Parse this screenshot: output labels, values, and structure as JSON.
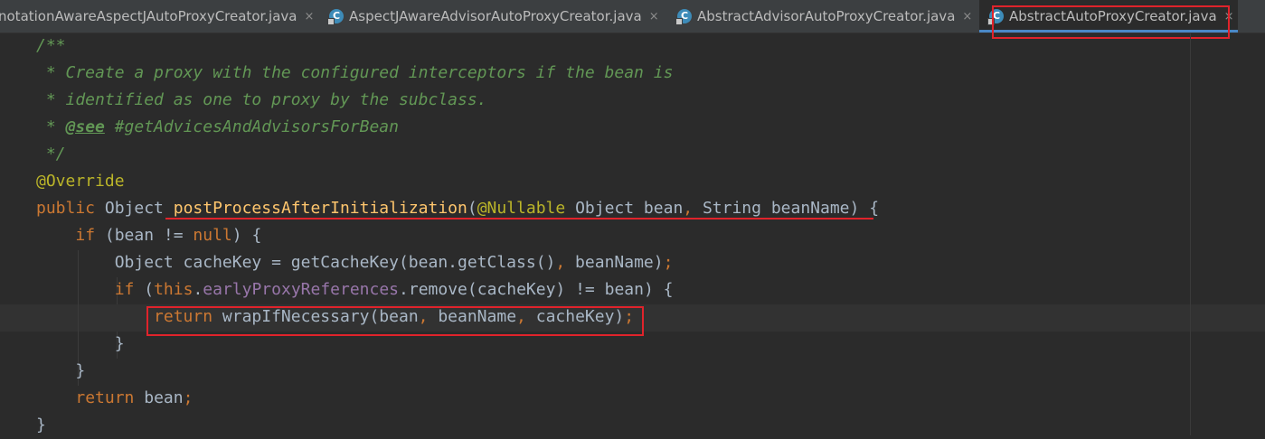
{
  "tabs": [
    {
      "label": "notationAwareAspectJAutoProxyCreator.java",
      "icon": "java-class-icon",
      "active": false
    },
    {
      "label": "AspectJAwareAdvisorAutoProxyCreator.java",
      "icon": "java-class-icon",
      "active": false
    },
    {
      "label": "AbstractAdvisorAutoProxyCreator.java",
      "icon": "java-class-icon",
      "active": false
    },
    {
      "label": "AbstractAutoProxyCreator.java",
      "icon": "java-class-icon",
      "active": true
    }
  ],
  "close_glyph": "×",
  "icon_letter": "C",
  "code": {
    "l1": "/**",
    "l2": " * Create a proxy with the configured interceptors if the bean is",
    "l3": " * identified as one to proxy by the subclass.",
    "l4_prefix": " * ",
    "l4_tag": "@see",
    "l4_rest": " #getAdvicesAndAdvisorsForBean",
    "l5": " */",
    "l6": "@Override",
    "l7": {
      "kw_public": "public",
      "type_object": " Object ",
      "method": "postProcessAfterInitialization",
      "paren_open": "(",
      "ann_nullable": "@Nullable",
      "param1": " Object bean",
      "comma": ",",
      "param2": " String beanName) {"
    },
    "l8": {
      "indent": "    ",
      "kw_if": "if",
      "a": " (bean != ",
      "kw_null": "null",
      "b": ") {"
    },
    "l9": {
      "indent": "        ",
      "a": "Object cacheKey = getCacheKey(bean.getClass()",
      "comma": ",",
      "b": " beanName)",
      "semi": ";"
    },
    "l10": {
      "indent": "        ",
      "kw_if": "if",
      "a": " (",
      "kw_this": "this",
      "dot": ".",
      "field": "earlyProxyReferences",
      "b": ".remove(cacheKey) != bean) {"
    },
    "l11": {
      "indent": "            ",
      "kw_return": "return",
      "a": " wrapIfNecessary(bean",
      "c1": ",",
      "b": " beanName",
      "c2": ",",
      "c": " cacheKey)",
      "semi": ";"
    },
    "l12": "        }",
    "l13": "    }",
    "l14": {
      "indent": "    ",
      "kw_return": "return",
      "a": " bean",
      "semi": ";"
    },
    "l15": "}"
  }
}
